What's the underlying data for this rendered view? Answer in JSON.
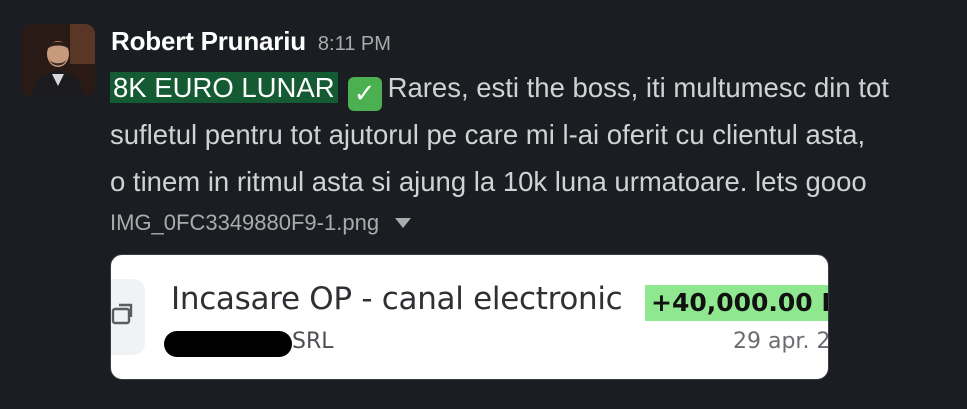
{
  "message": {
    "sender": "Robert Prunariu",
    "timestamp": "8:11 PM",
    "highlight_text": "8K EURO LUNAR",
    "emoji": "white-check-mark",
    "line1_rest": "Rares, esti the boss, iti multumesc din tot",
    "line2": "sufletul pentru tot ajutorul pe care mi l-ai oferit cu clientul asta,",
    "line3": "o tinem in ritmul asta si ajung la 10k luna urmatoare. lets gooo"
  },
  "attachment": {
    "file_name": "IMG_0FC3349880F9-1.png",
    "preview": {
      "title": "Incasare OP - canal electronic",
      "amount": "+40,000.00 R",
      "company_suffix": "SRL",
      "date": "29 apr. 2"
    }
  },
  "colors": {
    "background": "#1a1d21",
    "highlight_bg": "#145a32",
    "amount_bg": "#8fe88f",
    "check_bg": "#4caf50"
  }
}
